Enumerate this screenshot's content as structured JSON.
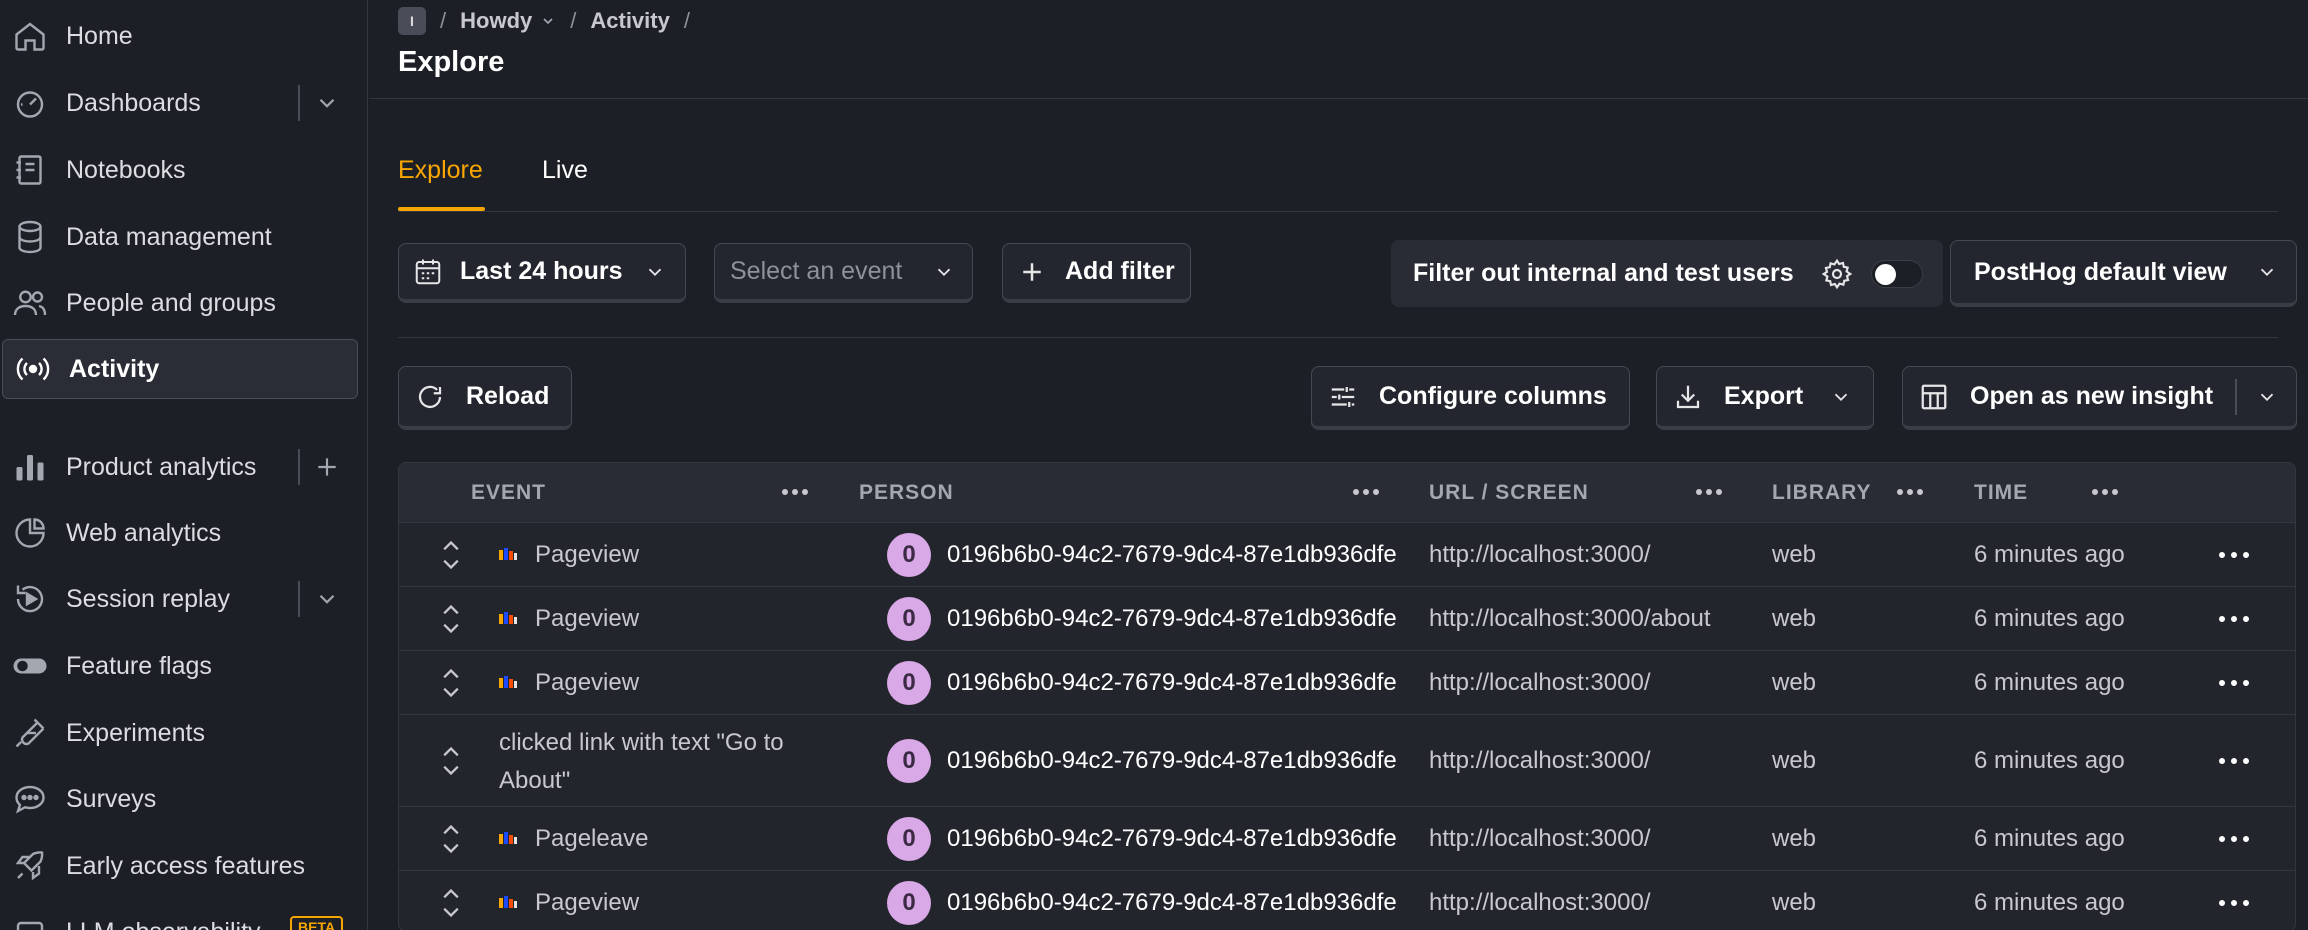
{
  "sidebar": {
    "items": [
      {
        "label": "Home",
        "icon": "home-icon"
      },
      {
        "label": "Dashboards",
        "icon": "dashboard-icon"
      },
      {
        "label": "Notebooks",
        "icon": "notebook-icon"
      },
      {
        "label": "Data management",
        "icon": "database-icon"
      },
      {
        "label": "People and groups",
        "icon": "people-icon"
      },
      {
        "label": "Activity",
        "icon": "activity-icon"
      },
      {
        "label": "Product analytics",
        "icon": "bar-chart-icon"
      },
      {
        "label": "Web analytics",
        "icon": "pie-chart-icon"
      },
      {
        "label": "Session replay",
        "icon": "replay-icon"
      },
      {
        "label": "Feature flags",
        "icon": "toggle-icon"
      },
      {
        "label": "Experiments",
        "icon": "flask-icon"
      },
      {
        "label": "Surveys",
        "icon": "chat-icon"
      },
      {
        "label": "Early access features",
        "icon": "rocket-icon"
      },
      {
        "label": "LLM observability",
        "icon": "llm-icon"
      }
    ],
    "beta_badge": "BETA"
  },
  "breadcrumb": {
    "project_initial": "I",
    "project": "Howdy",
    "section": "Activity"
  },
  "page_title": "Explore",
  "tabs": [
    {
      "label": "Explore"
    },
    {
      "label": "Live"
    }
  ],
  "filters": {
    "date_range": "Last 24 hours",
    "event_select_placeholder": "Select an event",
    "add_filter": "Add filter",
    "internal_filter_label": "Filter out internal and test users",
    "view_select": "PostHog default view"
  },
  "toolbar": {
    "reload": "Reload",
    "configure_columns": "Configure columns",
    "export": "Export",
    "open_insight": "Open as new insight"
  },
  "table": {
    "columns": [
      "EVENT",
      "PERSON",
      "URL / SCREEN",
      "LIBRARY",
      "TIME"
    ],
    "rows": [
      {
        "event": "Pageview",
        "has_icon": true,
        "person_initial": "0",
        "person": "0196b6b0-94c2-7679-9dc4-87e1db936dfe",
        "url": "http://localhost:3000/",
        "library": "web",
        "time": "6 minutes ago"
      },
      {
        "event": "Pageview",
        "has_icon": true,
        "person_initial": "0",
        "person": "0196b6b0-94c2-7679-9dc4-87e1db936dfe",
        "url": "http://localhost:3000/about",
        "library": "web",
        "time": "6 minutes ago"
      },
      {
        "event": "Pageview",
        "has_icon": true,
        "person_initial": "0",
        "person": "0196b6b0-94c2-7679-9dc4-87e1db936dfe",
        "url": "http://localhost:3000/",
        "library": "web",
        "time": "6 minutes ago"
      },
      {
        "event_line1": "clicked link with text \"Go to",
        "event_line2": "About\"",
        "has_icon": false,
        "person_initial": "0",
        "person": "0196b6b0-94c2-7679-9dc4-87e1db936dfe",
        "url": "http://localhost:3000/",
        "library": "web",
        "time": "6 minutes ago"
      },
      {
        "event": "Pageleave",
        "has_icon": true,
        "person_initial": "0",
        "person": "0196b6b0-94c2-7679-9dc4-87e1db936dfe",
        "url": "http://localhost:3000/",
        "library": "web",
        "time": "6 minutes ago"
      },
      {
        "event": "Pageview",
        "has_icon": true,
        "person_initial": "0",
        "person": "0196b6b0-94c2-7679-9dc4-87e1db936dfe",
        "url": "http://localhost:3000/",
        "library": "web",
        "time": "6 minutes ago"
      }
    ]
  },
  "colors": {
    "accent": "#f7a501",
    "background": "#1d1f27",
    "avatar": "#d9a8e6"
  }
}
